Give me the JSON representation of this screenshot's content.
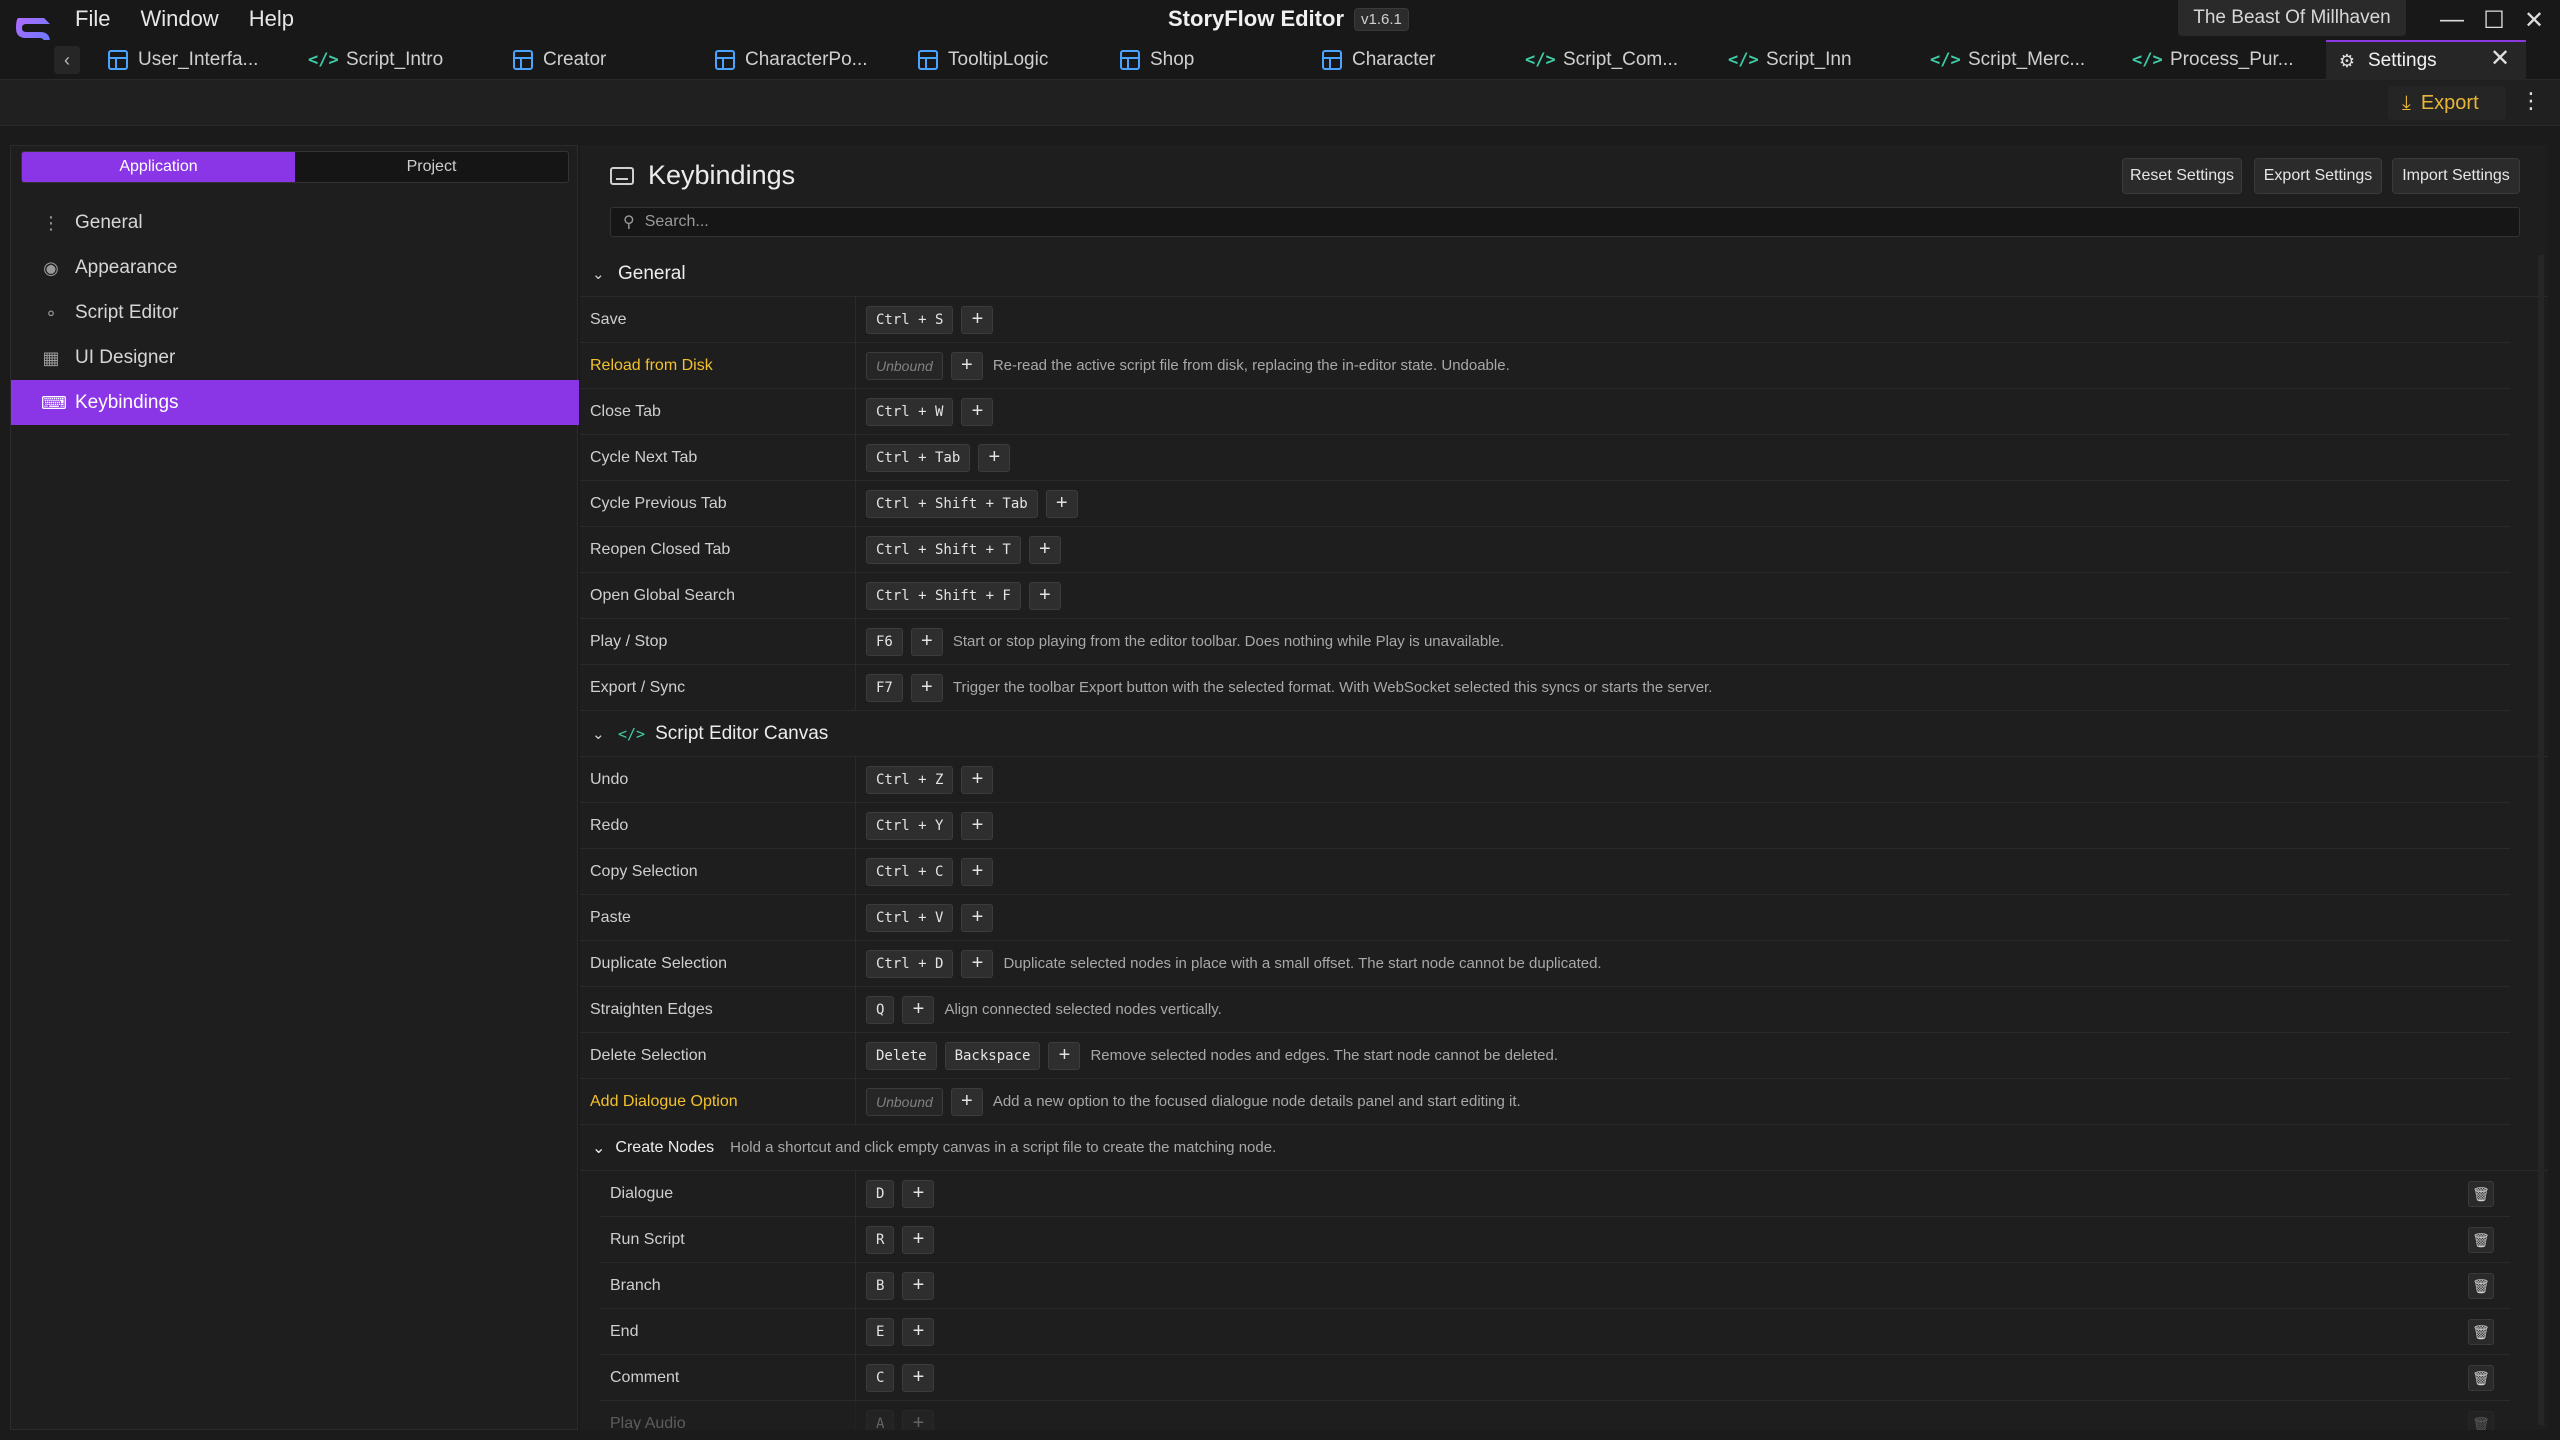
{
  "window": {
    "title": "StoryFlow Editor",
    "version": "v1.6.1",
    "project": "The Beast Of Millhaven"
  },
  "menu": [
    "File",
    "Window",
    "Help"
  ],
  "tabs": [
    {
      "label": "User_Interfa...",
      "icon": "ui-icon"
    },
    {
      "label": "Script_Intro",
      "icon": "code-icon"
    },
    {
      "label": "Creator",
      "icon": "ui-icon"
    },
    {
      "label": "CharacterPo...",
      "icon": "ui-icon"
    },
    {
      "label": "TooltipLogic",
      "icon": "ui-icon"
    },
    {
      "label": "Shop",
      "icon": "ui-icon"
    },
    {
      "label": "Character",
      "icon": "ui-icon"
    },
    {
      "label": "Script_Com...",
      "icon": "code-icon"
    },
    {
      "label": "Script_Inn",
      "icon": "code-icon"
    },
    {
      "label": "Script_Merc...",
      "icon": "code-icon"
    },
    {
      "label": "Process_Pur...",
      "icon": "code-icon"
    },
    {
      "label": "Settings",
      "icon": "gear-icon"
    }
  ],
  "toolbar": {
    "export_label": "Export"
  },
  "sidebar": {
    "segments": [
      "Application",
      "Project"
    ],
    "items": [
      {
        "label": "General",
        "icon": "sliders-icon"
      },
      {
        "label": "Appearance",
        "icon": "palette-icon"
      },
      {
        "label": "Script Editor",
        "icon": "nodes-icon"
      },
      {
        "label": "UI Designer",
        "icon": "layout-icon"
      },
      {
        "label": "Keybindings",
        "icon": "keyboard-icon"
      }
    ]
  },
  "main": {
    "title": "Keybindings",
    "buttons": {
      "reset": "Reset Settings",
      "export": "Export Settings",
      "import": "Import Settings"
    },
    "search_placeholder": "Search..."
  },
  "sections": {
    "general": {
      "title": "General",
      "rows": [
        {
          "label": "Save",
          "keys": [
            "Ctrl + S"
          ],
          "desc": ""
        },
        {
          "label": "Reload from Disk",
          "keys": [
            "Unbound"
          ],
          "desc": "Re-read the active script file from disk, replacing the in-editor state. Undoable."
        },
        {
          "label": "Close Tab",
          "keys": [
            "Ctrl + W"
          ],
          "desc": ""
        },
        {
          "label": "Cycle Next Tab",
          "keys": [
            "Ctrl + Tab"
          ],
          "desc": ""
        },
        {
          "label": "Cycle Previous Tab",
          "keys": [
            "Ctrl + Shift + Tab"
          ],
          "desc": ""
        },
        {
          "label": "Reopen Closed Tab",
          "keys": [
            "Ctrl + Shift + T"
          ],
          "desc": ""
        },
        {
          "label": "Open Global Search",
          "keys": [
            "Ctrl + Shift + F"
          ],
          "desc": ""
        },
        {
          "label": "Play / Stop",
          "keys": [
            "F6"
          ],
          "desc": "Start or stop playing from the editor toolbar. Does nothing while Play is unavailable."
        },
        {
          "label": "Export / Sync",
          "keys": [
            "F7"
          ],
          "desc": "Trigger the toolbar Export button with the selected format. With WebSocket selected this syncs or starts the server."
        }
      ]
    },
    "canvas": {
      "title": "Script Editor Canvas",
      "rows": [
        {
          "label": "Undo",
          "keys": [
            "Ctrl + Z"
          ],
          "desc": ""
        },
        {
          "label": "Redo",
          "keys": [
            "Ctrl + Y"
          ],
          "desc": ""
        },
        {
          "label": "Copy Selection",
          "keys": [
            "Ctrl + C"
          ],
          "desc": ""
        },
        {
          "label": "Paste",
          "keys": [
            "Ctrl + V"
          ],
          "desc": ""
        },
        {
          "label": "Duplicate Selection",
          "keys": [
            "Ctrl + D"
          ],
          "desc": "Duplicate selected nodes in place with a small offset. The start node cannot be duplicated."
        },
        {
          "label": "Straighten Edges",
          "keys": [
            "Q"
          ],
          "desc": "Align connected selected nodes vertically."
        },
        {
          "label": "Delete Selection",
          "keys": [
            "Delete",
            "Backspace"
          ],
          "desc": "Remove selected nodes and edges. The start node cannot be deleted."
        },
        {
          "label": "Add Dialogue Option",
          "keys": [
            "Unbound"
          ],
          "desc": "Add a new option to the focused dialogue node details panel and start editing it."
        }
      ]
    },
    "create_nodes": {
      "title": "Create Nodes",
      "desc": "Hold a shortcut and click empty canvas in a script file to create the matching node.",
      "rows": [
        {
          "label": "Dialogue",
          "keys": [
            "D"
          ]
        },
        {
          "label": "Run Script",
          "keys": [
            "R"
          ]
        },
        {
          "label": "Branch",
          "keys": [
            "B"
          ]
        },
        {
          "label": "End",
          "keys": [
            "E"
          ]
        },
        {
          "label": "Comment",
          "keys": [
            "C"
          ]
        },
        {
          "label": "Play Audio",
          "keys": [
            "A"
          ]
        }
      ]
    }
  },
  "colors": {
    "accent": "#8a35e6",
    "warning": "#f2c12e",
    "export": "#e8b637",
    "code": "#3fcfa8",
    "ui": "#4aa3ff"
  }
}
